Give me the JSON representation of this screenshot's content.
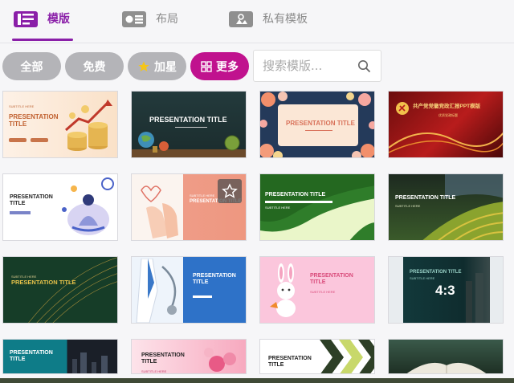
{
  "tabs": [
    {
      "label": "模版",
      "active": true
    },
    {
      "label": "布局",
      "active": false
    },
    {
      "label": "私有模板",
      "active": false
    }
  ],
  "filters": [
    {
      "label": "全部"
    },
    {
      "label": "免费"
    },
    {
      "label": "加星"
    },
    {
      "label": "更多",
      "active": true
    }
  ],
  "search": {
    "placeholder": "搜索模版..."
  },
  "colors": {
    "accent": "#8a1fa8",
    "active_chip": "#c0128e",
    "chip": "#b4b4b8"
  },
  "templates": [
    {
      "title": "PRESENTATION TITLE",
      "subtitle": "SUBTITLE HERE",
      "theme": "gold-coins"
    },
    {
      "title": "PRESENTATION TITLE",
      "theme": "chalkboard-globe"
    },
    {
      "title": "PRESENTATION TITLE",
      "theme": "floral-frame"
    },
    {
      "title": "共产党党徽党政汇报PPT模版",
      "subtitle": "优质党政标题",
      "theme": "red-party"
    },
    {
      "title": "PRESENTATION\nTITLE",
      "theme": "meditation"
    },
    {
      "title": "PRESENTATION TITLE",
      "subtitle": "SUBTITLE HERE",
      "theme": "hands-heart"
    },
    {
      "title": "PRESENTATION TITLE",
      "subtitle": "SUBTITLE HERE",
      "theme": "green-leaves"
    },
    {
      "title": "PRESENTATION TITLE",
      "subtitle": "SUBTITLE HERE",
      "theme": "terraces"
    },
    {
      "title": "PRESENTATION TITLE",
      "subtitle": "SUBTITLE HERE",
      "theme": "green-lines"
    },
    {
      "title": "PRESENTATION\nTITLE",
      "theme": "medical-stethoscope"
    },
    {
      "title": "PRESENTATION\nTITLE",
      "subtitle": "SUBTITLE HERE",
      "theme": "bunny-pink"
    },
    {
      "title": "PRESENTATION TITLE",
      "subtitle": "SUBTITLE HERE",
      "badge": "4:3",
      "theme": "dark-teal-4-3"
    },
    {
      "title": "PRESENTATION\nTITLE",
      "theme": "teal-city"
    },
    {
      "title": "PRESENTATION\nTITLE",
      "subtitle": "SUBTITLE HERE",
      "theme": "pink-flowers"
    },
    {
      "title": "PRESENTATION\nTITLE",
      "theme": "chevrons"
    },
    {
      "title": "",
      "theme": "open-book"
    }
  ]
}
